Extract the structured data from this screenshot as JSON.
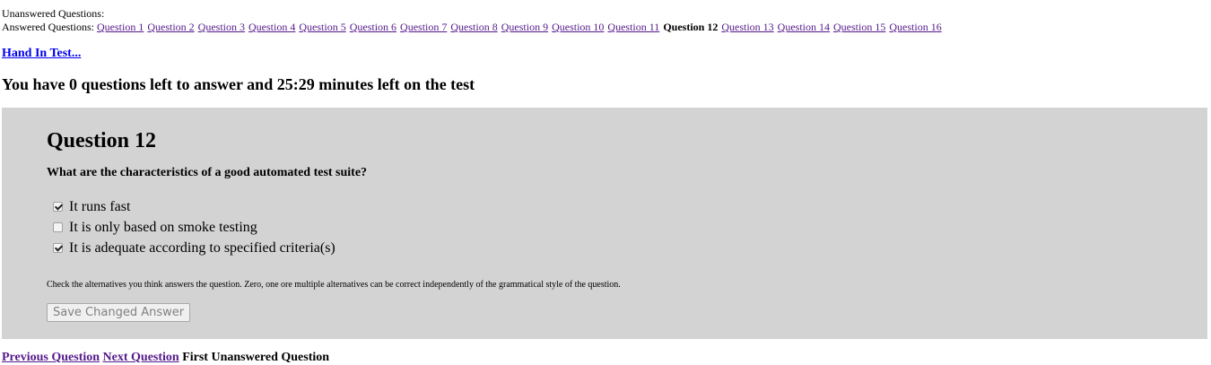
{
  "nav": {
    "unanswered_label": "Unanswered Questions:",
    "answered_label": "Answered Questions:",
    "questions": [
      "Question 1",
      "Question 2",
      "Question 3",
      "Question 4",
      "Question 5",
      "Question 6",
      "Question 7",
      "Question 8",
      "Question 9",
      "Question 10",
      "Question 11",
      "Question 12",
      "Question 13",
      "Question 14",
      "Question 15",
      "Question 16"
    ],
    "current": "Question 12"
  },
  "hand_in": "Hand In Test...",
  "status": "You have 0 questions left to answer and 25:29 minutes left on the test",
  "question": {
    "title": "Question 12",
    "prompt": "What are the characteristics of a good automated test suite?",
    "options": [
      {
        "label": "It runs fast",
        "checked": true
      },
      {
        "label": "It is only based on smoke testing",
        "checked": false
      },
      {
        "label": "It is adequate according to specified criteria(s)",
        "checked": true
      }
    ],
    "hint": "Check the alternatives you think answers the question. Zero, one ore multiple alternatives can be correct independently of the grammatical style of the question.",
    "save_label": "Save Changed Answer"
  },
  "footer": {
    "previous": "Previous Question",
    "next": "Next Question",
    "first_unanswered": "First Unanswered Question"
  },
  "colors": {
    "panel_bg": "#d3d3d3",
    "visited_link": "#551a8b",
    "link": "#0000ee"
  }
}
